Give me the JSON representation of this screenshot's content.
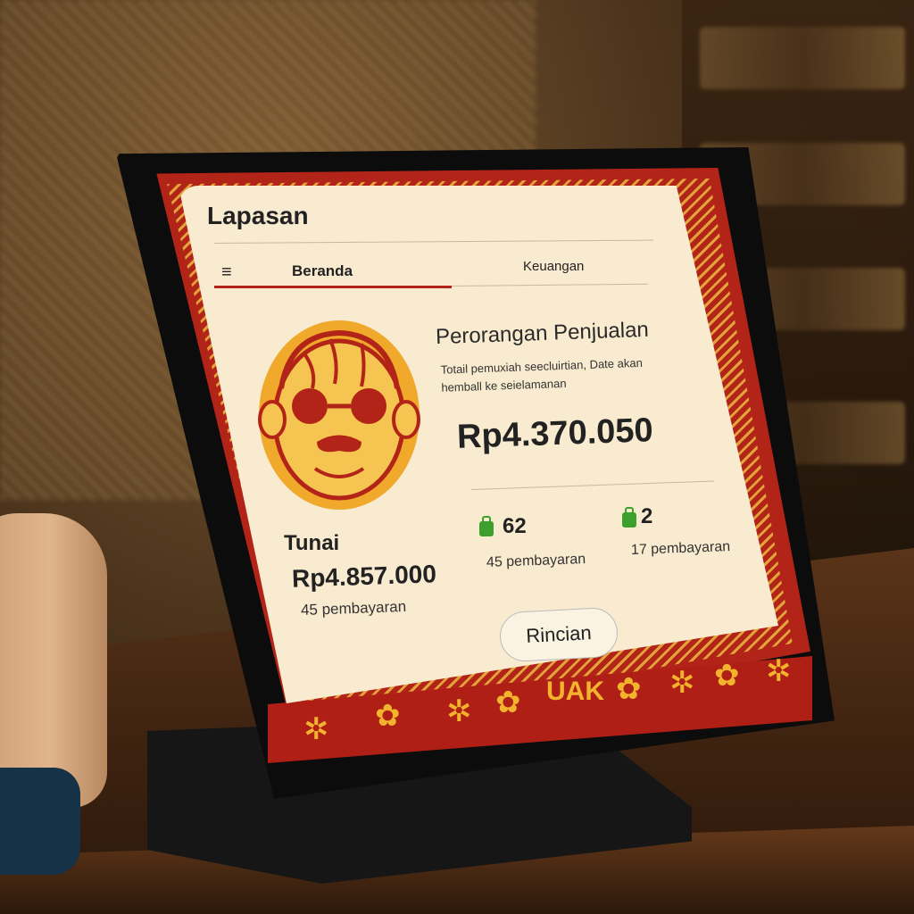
{
  "app": {
    "title": "Lapasan"
  },
  "nav": {
    "menu_icon": "≡",
    "tabs": [
      {
        "label": "Beranda",
        "active": true
      },
      {
        "label": "Keuangan",
        "active": false
      }
    ]
  },
  "sales": {
    "heading": "Perorangan Penjualan",
    "subtitle": "Totail pemuxiah seecluirtian, Date akan hemball ke seielamanan",
    "total": "Rp4.370.050"
  },
  "stats": [
    {
      "icon": "green-bag-icon",
      "value": "62",
      "label": "45 pembayaran"
    },
    {
      "icon": "green-bag-icon",
      "value": "2",
      "label": "17 pembayaran"
    }
  ],
  "cash": {
    "label": "Tunai",
    "amount": "Rp4.857.000",
    "count": "45 pembayaran"
  },
  "actions": {
    "details_button": "Rincian"
  },
  "border_text": "UAK",
  "colors": {
    "accent_red": "#b22418",
    "gold": "#f2b32d",
    "screen_bg": "#f8ebcf",
    "bag_green": "#3da02c"
  }
}
